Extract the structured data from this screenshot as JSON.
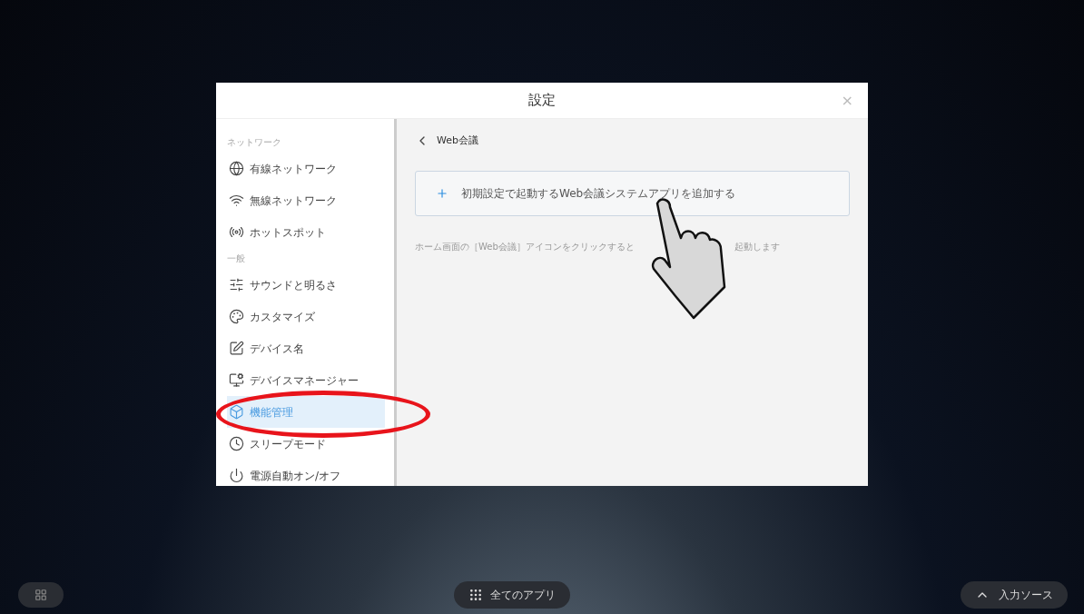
{
  "dialog": {
    "title": "設定",
    "close": "×"
  },
  "sidebar": {
    "sections": [
      {
        "heading": "ネットワーク",
        "items": [
          {
            "label": "有線ネットワーク",
            "selected": false
          },
          {
            "label": "無線ネットワーク",
            "selected": false
          },
          {
            "label": "ホットスポット",
            "selected": false
          }
        ]
      },
      {
        "heading": "一般",
        "items": [
          {
            "label": "サウンドと明るさ",
            "selected": false
          },
          {
            "label": "カスタマイズ",
            "selected": false
          },
          {
            "label": "デバイス名",
            "selected": false
          },
          {
            "label": "デバイスマネージャー",
            "selected": false
          },
          {
            "label": "機能管理",
            "selected": true
          },
          {
            "label": "スリープモード",
            "selected": false
          },
          {
            "label": "電源自動オン/オフ",
            "selected": false
          }
        ]
      }
    ]
  },
  "content": {
    "back_title": "Web会議",
    "add_button": "初期設定で起動するWeb会議システムアプリを追加する",
    "hint_parts": [
      "ホーム画面の［Web会議］アイコンをクリックすると",
      "起動します"
    ]
  },
  "taskbar": {
    "all_apps": "全てのアプリ",
    "input_source": "入力ソース"
  }
}
